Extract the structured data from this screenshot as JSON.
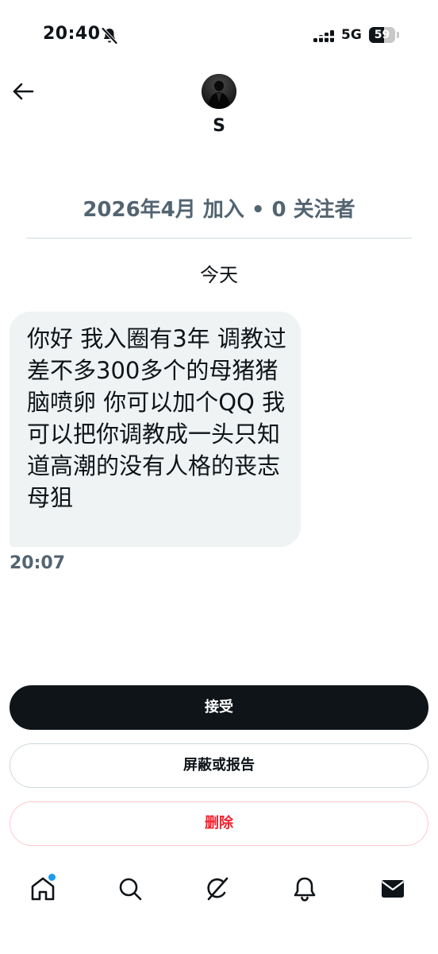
{
  "status_bar": {
    "time": "20:40",
    "mute_icon": "bell-slash-icon",
    "signal_icon": "signal-dots-icon",
    "network": "5G",
    "battery_level": "59",
    "battery_fraction": 0.59
  },
  "header": {
    "back_icon": "arrow-left-icon",
    "avatar": "contact-avatar",
    "name": "S",
    "meta": "2026年4月 加入 • 0 关注者"
  },
  "conversation": {
    "date_label": "今天",
    "messages": [
      {
        "text": "你好 我入圈有3年 调教过差不多300多个的母猪猪脑喷卵 你可以加个QQ 我可以把你调教成一头只知道高潮的没有人格的丧志母狙",
        "time": "20:07"
      }
    ]
  },
  "actions": {
    "accept_label": "接受",
    "block_report_label": "屏蔽或报告",
    "delete_label": "删除"
  },
  "tab_bar": {
    "items": [
      {
        "icon": "home-icon",
        "has_notification_dot": true
      },
      {
        "icon": "search-icon"
      },
      {
        "icon": "grok-icon"
      },
      {
        "icon": "bell-icon"
      },
      {
        "icon": "mail-icon"
      }
    ]
  },
  "colors": {
    "text_primary": "#0f1419",
    "text_secondary": "#536471",
    "bubble_bg": "#eff3f4",
    "accent_blue": "#1d9bf0",
    "danger_red": "#f4212e"
  }
}
